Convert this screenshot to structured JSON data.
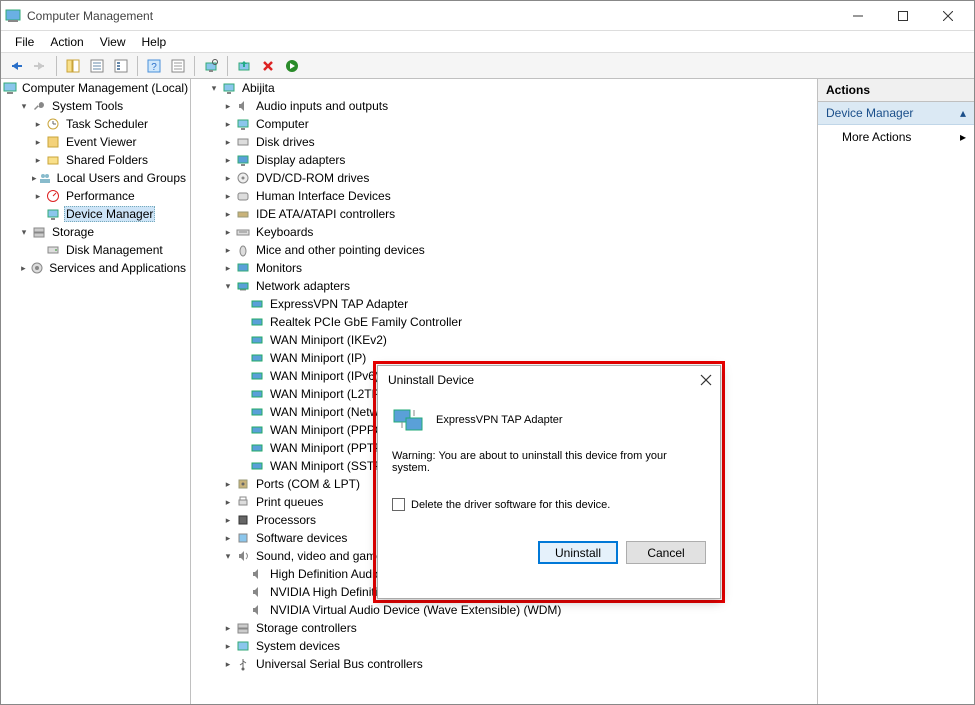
{
  "window": {
    "title": "Computer Management"
  },
  "menus": [
    "File",
    "Action",
    "View",
    "Help"
  ],
  "leftTree": {
    "root": "Computer Management (Local)",
    "systemTools": "System Tools",
    "taskScheduler": "Task Scheduler",
    "eventViewer": "Event Viewer",
    "sharedFolders": "Shared Folders",
    "localUsers": "Local Users and Groups",
    "performance": "Performance",
    "deviceManager": "Device Manager",
    "storage": "Storage",
    "diskManagement": "Disk Management",
    "services": "Services and Applications"
  },
  "midTree": {
    "root": "Abijita",
    "items": [
      "Audio inputs and outputs",
      "Computer",
      "Disk drives",
      "Display adapters",
      "DVD/CD-ROM drives",
      "Human Interface Devices",
      "IDE ATA/ATAPI controllers",
      "Keyboards",
      "Mice and other pointing devices",
      "Monitors"
    ],
    "network": "Network adapters",
    "adapters": [
      "ExpressVPN TAP Adapter",
      "Realtek PCIe GbE Family Controller",
      "WAN Miniport (IKEv2)",
      "WAN Miniport (IP)",
      "WAN Miniport (IPv6)",
      "WAN Miniport (L2TP)",
      "WAN Miniport (Network Monitor)",
      "WAN Miniport (PPPOE)",
      "WAN Miniport (PPTP)",
      "WAN Miniport (SSTP)"
    ],
    "footerItems": [
      "Ports (COM & LPT)",
      "Print queues",
      "Processors",
      "Software devices"
    ],
    "sound": "Sound, video and game controllers",
    "soundItems": [
      "High Definition Audio Device",
      "NVIDIA High Definition Audio",
      "NVIDIA Virtual Audio Device (Wave Extensible) (WDM)"
    ],
    "tail": [
      "Storage controllers",
      "System devices",
      "Universal Serial Bus controllers"
    ]
  },
  "actions": {
    "header": "Actions",
    "section": "Device Manager",
    "more": "More Actions"
  },
  "dialog": {
    "title": "Uninstall Device",
    "device": "ExpressVPN TAP Adapter",
    "warning": "Warning: You are about to uninstall this device from your system.",
    "checkbox": "Delete the driver software for this device.",
    "uninstall": "Uninstall",
    "cancel": "Cancel"
  }
}
